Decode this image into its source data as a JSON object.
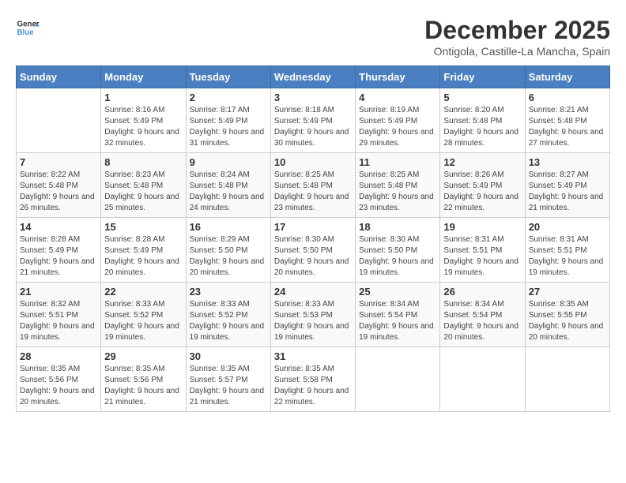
{
  "logo": {
    "line1": "General",
    "line2": "Blue"
  },
  "title": "December 2025",
  "subtitle": "Ontigola, Castille-La Mancha, Spain",
  "weekdays": [
    "Sunday",
    "Monday",
    "Tuesday",
    "Wednesday",
    "Thursday",
    "Friday",
    "Saturday"
  ],
  "weeks": [
    [
      {
        "day": "",
        "sunrise": "",
        "sunset": "",
        "daylight": ""
      },
      {
        "day": "1",
        "sunrise": "Sunrise: 8:16 AM",
        "sunset": "Sunset: 5:49 PM",
        "daylight": "Daylight: 9 hours and 32 minutes."
      },
      {
        "day": "2",
        "sunrise": "Sunrise: 8:17 AM",
        "sunset": "Sunset: 5:49 PM",
        "daylight": "Daylight: 9 hours and 31 minutes."
      },
      {
        "day": "3",
        "sunrise": "Sunrise: 8:18 AM",
        "sunset": "Sunset: 5:49 PM",
        "daylight": "Daylight: 9 hours and 30 minutes."
      },
      {
        "day": "4",
        "sunrise": "Sunrise: 8:19 AM",
        "sunset": "Sunset: 5:49 PM",
        "daylight": "Daylight: 9 hours and 29 minutes."
      },
      {
        "day": "5",
        "sunrise": "Sunrise: 8:20 AM",
        "sunset": "Sunset: 5:48 PM",
        "daylight": "Daylight: 9 hours and 28 minutes."
      },
      {
        "day": "6",
        "sunrise": "Sunrise: 8:21 AM",
        "sunset": "Sunset: 5:48 PM",
        "daylight": "Daylight: 9 hours and 27 minutes."
      }
    ],
    [
      {
        "day": "7",
        "sunrise": "Sunrise: 8:22 AM",
        "sunset": "Sunset: 5:48 PM",
        "daylight": "Daylight: 9 hours and 26 minutes."
      },
      {
        "day": "8",
        "sunrise": "Sunrise: 8:23 AM",
        "sunset": "Sunset: 5:48 PM",
        "daylight": "Daylight: 9 hours and 25 minutes."
      },
      {
        "day": "9",
        "sunrise": "Sunrise: 8:24 AM",
        "sunset": "Sunset: 5:48 PM",
        "daylight": "Daylight: 9 hours and 24 minutes."
      },
      {
        "day": "10",
        "sunrise": "Sunrise: 8:25 AM",
        "sunset": "Sunset: 5:48 PM",
        "daylight": "Daylight: 9 hours and 23 minutes."
      },
      {
        "day": "11",
        "sunrise": "Sunrise: 8:25 AM",
        "sunset": "Sunset: 5:48 PM",
        "daylight": "Daylight: 9 hours and 23 minutes."
      },
      {
        "day": "12",
        "sunrise": "Sunrise: 8:26 AM",
        "sunset": "Sunset: 5:49 PM",
        "daylight": "Daylight: 9 hours and 22 minutes."
      },
      {
        "day": "13",
        "sunrise": "Sunrise: 8:27 AM",
        "sunset": "Sunset: 5:49 PM",
        "daylight": "Daylight: 9 hours and 21 minutes."
      }
    ],
    [
      {
        "day": "14",
        "sunrise": "Sunrise: 8:28 AM",
        "sunset": "Sunset: 5:49 PM",
        "daylight": "Daylight: 9 hours and 21 minutes."
      },
      {
        "day": "15",
        "sunrise": "Sunrise: 8:28 AM",
        "sunset": "Sunset: 5:49 PM",
        "daylight": "Daylight: 9 hours and 20 minutes."
      },
      {
        "day": "16",
        "sunrise": "Sunrise: 8:29 AM",
        "sunset": "Sunset: 5:50 PM",
        "daylight": "Daylight: 9 hours and 20 minutes."
      },
      {
        "day": "17",
        "sunrise": "Sunrise: 8:30 AM",
        "sunset": "Sunset: 5:50 PM",
        "daylight": "Daylight: 9 hours and 20 minutes."
      },
      {
        "day": "18",
        "sunrise": "Sunrise: 8:30 AM",
        "sunset": "Sunset: 5:50 PM",
        "daylight": "Daylight: 9 hours and 19 minutes."
      },
      {
        "day": "19",
        "sunrise": "Sunrise: 8:31 AM",
        "sunset": "Sunset: 5:51 PM",
        "daylight": "Daylight: 9 hours and 19 minutes."
      },
      {
        "day": "20",
        "sunrise": "Sunrise: 8:31 AM",
        "sunset": "Sunset: 5:51 PM",
        "daylight": "Daylight: 9 hours and 19 minutes."
      }
    ],
    [
      {
        "day": "21",
        "sunrise": "Sunrise: 8:32 AM",
        "sunset": "Sunset: 5:51 PM",
        "daylight": "Daylight: 9 hours and 19 minutes."
      },
      {
        "day": "22",
        "sunrise": "Sunrise: 8:33 AM",
        "sunset": "Sunset: 5:52 PM",
        "daylight": "Daylight: 9 hours and 19 minutes."
      },
      {
        "day": "23",
        "sunrise": "Sunrise: 8:33 AM",
        "sunset": "Sunset: 5:52 PM",
        "daylight": "Daylight: 9 hours and 19 minutes."
      },
      {
        "day": "24",
        "sunrise": "Sunrise: 8:33 AM",
        "sunset": "Sunset: 5:53 PM",
        "daylight": "Daylight: 9 hours and 19 minutes."
      },
      {
        "day": "25",
        "sunrise": "Sunrise: 8:34 AM",
        "sunset": "Sunset: 5:54 PM",
        "daylight": "Daylight: 9 hours and 19 minutes."
      },
      {
        "day": "26",
        "sunrise": "Sunrise: 8:34 AM",
        "sunset": "Sunset: 5:54 PM",
        "daylight": "Daylight: 9 hours and 20 minutes."
      },
      {
        "day": "27",
        "sunrise": "Sunrise: 8:35 AM",
        "sunset": "Sunset: 5:55 PM",
        "daylight": "Daylight: 9 hours and 20 minutes."
      }
    ],
    [
      {
        "day": "28",
        "sunrise": "Sunrise: 8:35 AM",
        "sunset": "Sunset: 5:56 PM",
        "daylight": "Daylight: 9 hours and 20 minutes."
      },
      {
        "day": "29",
        "sunrise": "Sunrise: 8:35 AM",
        "sunset": "Sunset: 5:56 PM",
        "daylight": "Daylight: 9 hours and 21 minutes."
      },
      {
        "day": "30",
        "sunrise": "Sunrise: 8:35 AM",
        "sunset": "Sunset: 5:57 PM",
        "daylight": "Daylight: 9 hours and 21 minutes."
      },
      {
        "day": "31",
        "sunrise": "Sunrise: 8:35 AM",
        "sunset": "Sunset: 5:58 PM",
        "daylight": "Daylight: 9 hours and 22 minutes."
      },
      {
        "day": "",
        "sunrise": "",
        "sunset": "",
        "daylight": ""
      },
      {
        "day": "",
        "sunrise": "",
        "sunset": "",
        "daylight": ""
      },
      {
        "day": "",
        "sunrise": "",
        "sunset": "",
        "daylight": ""
      }
    ]
  ]
}
